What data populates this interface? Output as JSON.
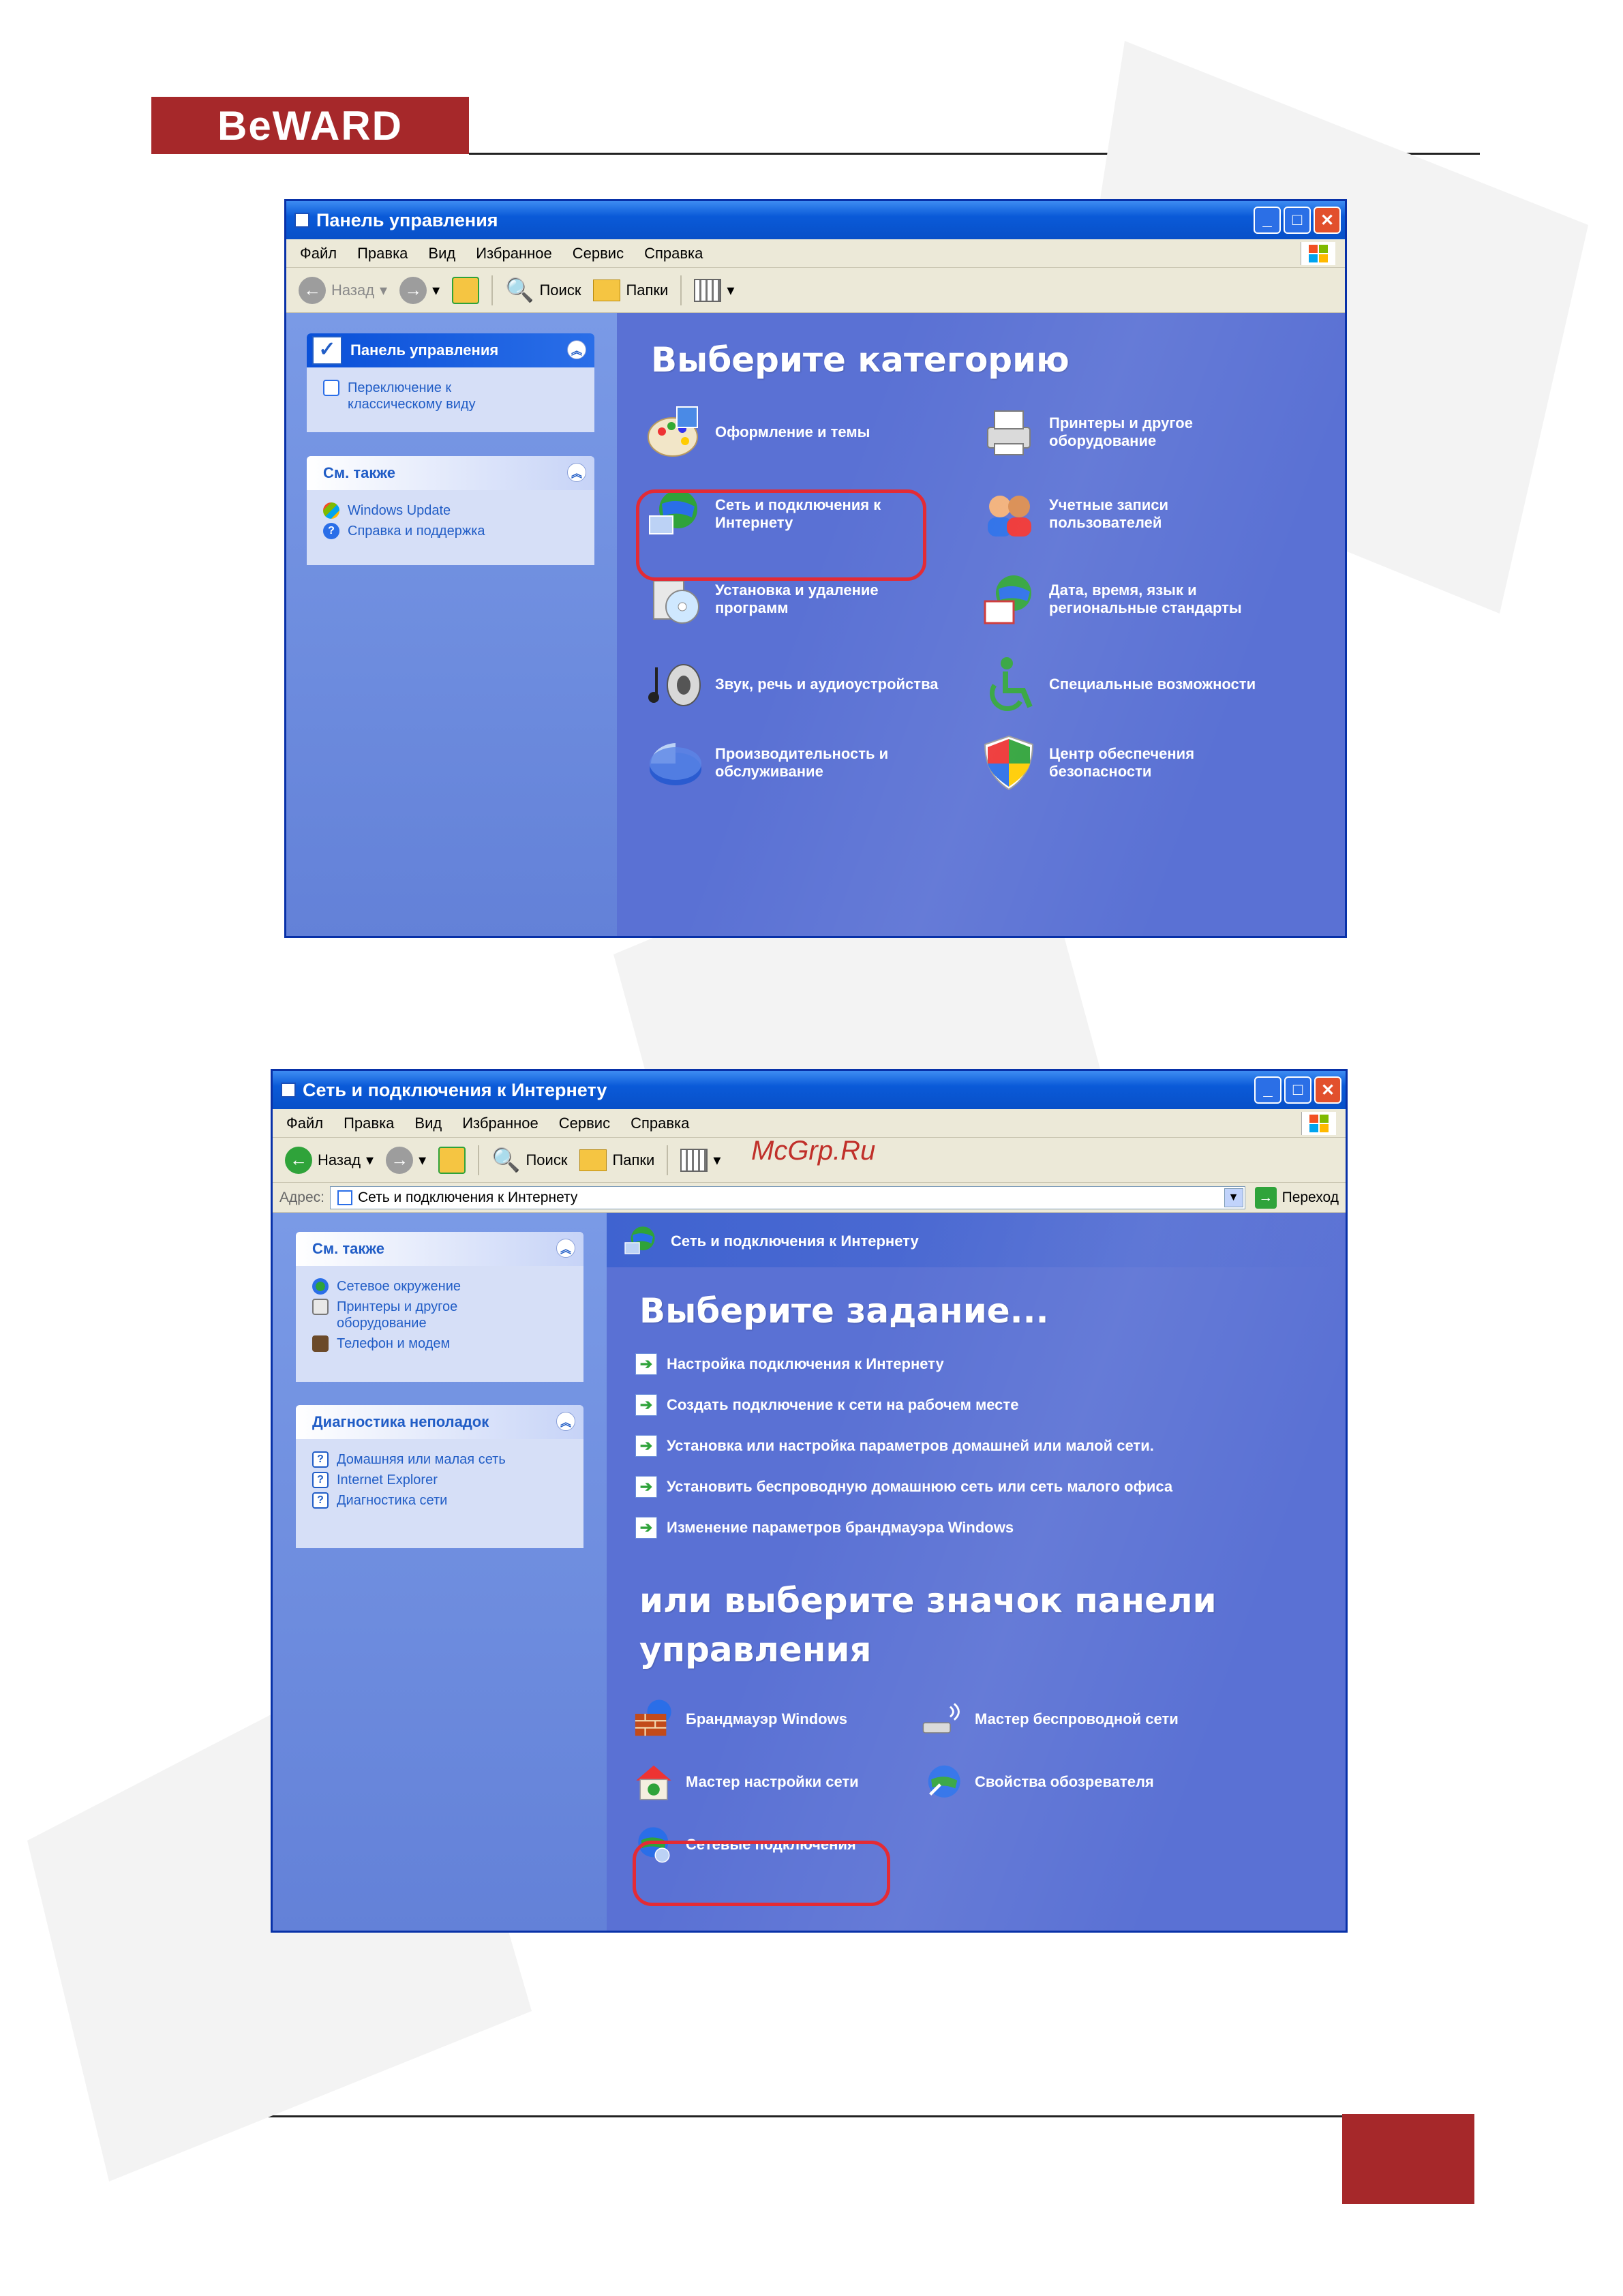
{
  "page": {
    "logo_text": "BeWARD",
    "watermark_text": "McGrp.Ru"
  },
  "window1": {
    "title": "Панель управления",
    "menu": [
      "Файл",
      "Правка",
      "Вид",
      "Избранное",
      "Сервис",
      "Справка"
    ],
    "toolbar": {
      "back": "Назад",
      "search": "Поиск",
      "folders": "Папки"
    },
    "left_panel": {
      "header": "Панель управления",
      "switch_view": "Переключение к классическому виду"
    },
    "see_also": {
      "header": "См. также",
      "items": [
        "Windows Update",
        "Справка и поддержка"
      ]
    },
    "heading": "Выберите категорию",
    "categories": [
      "Оформление и темы",
      "Принтеры и другое оборудование",
      "Сеть и подключения к Интернету",
      "Учетные записи пользователей",
      "Установка и удаление программ",
      "Дата, время, язык и региональные стандарты",
      "Звук, речь и аудиоустройства",
      "Специальные возможности",
      "Производительность и обслуживание",
      "Центр обеспечения безопасности"
    ]
  },
  "window2": {
    "title": "Сеть и подключения к Интернету",
    "menu": [
      "Файл",
      "Правка",
      "Вид",
      "Избранное",
      "Сервис",
      "Справка"
    ],
    "toolbar": {
      "back": "Назад",
      "search": "Поиск",
      "folders": "Папки"
    },
    "address": {
      "label": "Адрес:",
      "value": "Сеть и подключения к Интернету",
      "go": "Переход"
    },
    "see_also": {
      "header": "См. также",
      "items": [
        "Сетевое окружение",
        "Принтеры и другое оборудование",
        "Телефон и модем"
      ]
    },
    "troubleshoot": {
      "header": "Диагностика неполадок",
      "items": [
        "Домашняя или малая сеть",
        "Internet Explorer",
        "Диагностика сети"
      ]
    },
    "section_title": "Сеть и подключения к Интернету",
    "heading_tasks": "Выберите задание...",
    "tasks": [
      "Настройка подключения к Интернету",
      "Создать подключение к сети на рабочем месте",
      "Установка или настройка параметров домашней или малой сети.",
      "Установить беспроводную домашнюю сеть или сеть малого офиса",
      "Изменение параметров брандмауэра Windows"
    ],
    "heading_icons_1": "или выберите значок панели",
    "heading_icons_2": "управления",
    "icons": [
      "Брандмауэр Windows",
      "Мастер беспроводной сети",
      "Мастер настройки сети",
      "Свойства обозревателя",
      "Сетевые подключения"
    ]
  }
}
